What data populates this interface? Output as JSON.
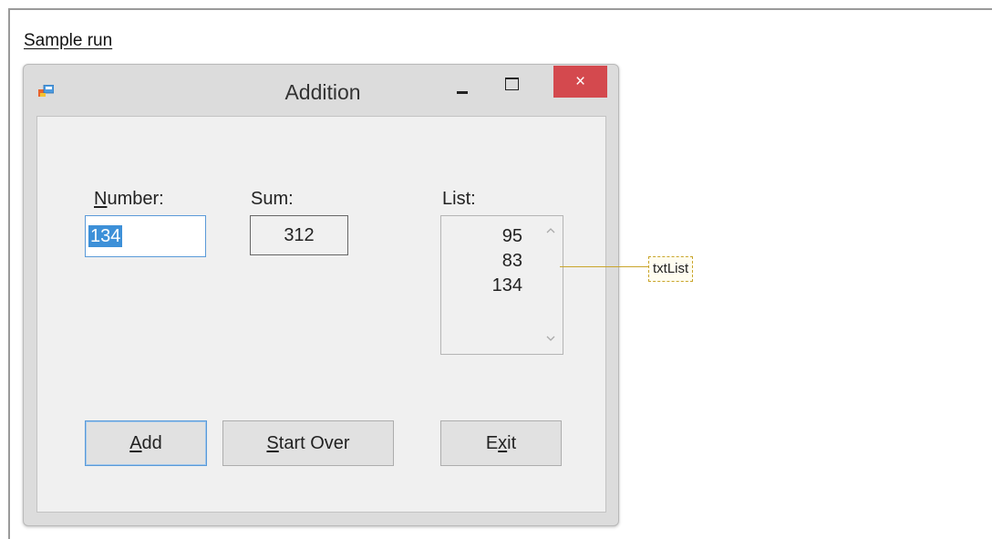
{
  "caption": "Sample run",
  "window": {
    "title": "Addition",
    "controls": {
      "minimize": "–",
      "close": "×"
    }
  },
  "form": {
    "number_label_key": "N",
    "number_label_rest": "umber:",
    "number_value": "134",
    "sum_label": "Sum:",
    "sum_value": "312",
    "list_label": "List:",
    "list_items": [
      "95",
      "83",
      "134"
    ]
  },
  "buttons": {
    "add_key": "A",
    "add_rest": "dd",
    "start_key": "S",
    "start_rest": "tart Over",
    "exit_pre": "E",
    "exit_key": "x",
    "exit_rest": "it"
  },
  "callout": "txtList",
  "icons": {
    "app": "application-icon",
    "minimize": "minimize-icon",
    "maximize": "maximize-icon",
    "close": "close-icon",
    "scroll_up": "chevron-up-icon",
    "scroll_down": "chevron-down-icon"
  },
  "colors": {
    "close_button": "#d4494e",
    "selection": "#3d90d8",
    "focus_border": "#5a9ad8",
    "callout_border": "#c9a52c"
  }
}
